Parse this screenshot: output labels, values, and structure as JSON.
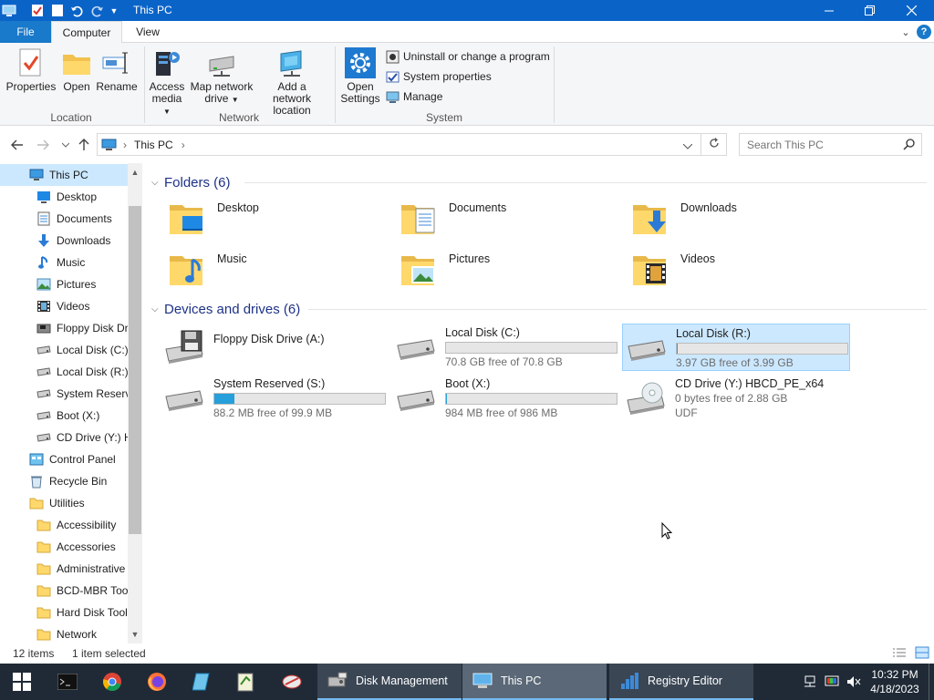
{
  "window": {
    "title": "This PC"
  },
  "ribbon": {
    "tabs": {
      "file": "File",
      "computer": "Computer",
      "view": "View"
    },
    "location": {
      "label": "Location",
      "properties": "Properties",
      "open": "Open",
      "rename": "Rename"
    },
    "network": {
      "label": "Network",
      "access_media_1": "Access",
      "access_media_2": "media",
      "map_drive_1": "Map network",
      "map_drive_2": "drive",
      "add_location_1": "Add a network",
      "add_location_2": "location"
    },
    "system": {
      "label": "System",
      "open_settings_1": "Open",
      "open_settings_2": "Settings",
      "uninstall": "Uninstall or change a program",
      "system_properties": "System properties",
      "manage": "Manage"
    }
  },
  "address": {
    "path": "This PC",
    "search_placeholder": "Search This PC"
  },
  "nav": {
    "items": [
      {
        "label": "This PC",
        "icon": "computer-icon",
        "level": 1,
        "selected": true
      },
      {
        "label": "Desktop",
        "icon": "desktop-icon",
        "level": 2
      },
      {
        "label": "Documents",
        "icon": "documents-icon",
        "level": 2
      },
      {
        "label": "Downloads",
        "icon": "downloads-icon",
        "level": 2
      },
      {
        "label": "Music",
        "icon": "music-icon",
        "level": 2
      },
      {
        "label": "Pictures",
        "icon": "pictures-icon",
        "level": 2
      },
      {
        "label": "Videos",
        "icon": "videos-icon",
        "level": 2
      },
      {
        "label": "Floppy Disk Dri",
        "icon": "floppy-icon",
        "level": 2
      },
      {
        "label": "Local Disk (C:)",
        "icon": "drive-icon",
        "level": 2
      },
      {
        "label": "Local Disk (R:)",
        "icon": "drive-icon",
        "level": 2
      },
      {
        "label": "System Reserve",
        "icon": "drive-icon",
        "level": 2
      },
      {
        "label": "Boot (X:)",
        "icon": "drive-icon",
        "level": 2
      },
      {
        "label": "CD Drive (Y:) H",
        "icon": "drive-icon",
        "level": 2
      },
      {
        "label": "Control Panel",
        "icon": "control-panel-icon",
        "level": 1
      },
      {
        "label": "Recycle Bin",
        "icon": "recycle-bin-icon",
        "level": 1
      },
      {
        "label": "Utilities",
        "icon": "folder-icon",
        "level": 1
      },
      {
        "label": "Accessibility",
        "icon": "folder-icon",
        "level": 2
      },
      {
        "label": "Accessories",
        "icon": "folder-icon",
        "level": 2
      },
      {
        "label": "Administrative",
        "icon": "folder-icon",
        "level": 2
      },
      {
        "label": "BCD-MBR Tool",
        "icon": "folder-icon",
        "level": 2
      },
      {
        "label": "Hard Disk Tool:",
        "icon": "folder-icon",
        "level": 2
      },
      {
        "label": "Network",
        "icon": "folder-icon",
        "level": 2
      }
    ]
  },
  "content": {
    "folders_header": "Folders (6)",
    "folders": [
      {
        "name": "Desktop",
        "icon": "desktop-folder-icon"
      },
      {
        "name": "Documents",
        "icon": "documents-folder-icon"
      },
      {
        "name": "Downloads",
        "icon": "downloads-folder-icon"
      },
      {
        "name": "Music",
        "icon": "music-folder-icon"
      },
      {
        "name": "Pictures",
        "icon": "pictures-folder-icon"
      },
      {
        "name": "Videos",
        "icon": "videos-folder-icon"
      }
    ],
    "drives_header": "Devices and drives (6)",
    "drives": [
      {
        "name": "Floppy Disk Drive (A:)",
        "icon": "floppy-drive-icon"
      },
      {
        "name": "Local Disk (C:)",
        "free": "70.8 GB free of 70.8 GB",
        "used_fraction": 0.0,
        "icon": "hard-drive-icon"
      },
      {
        "name": "Local Disk (R:)",
        "free": "3.97 GB free of 3.99 GB",
        "used_fraction": 0.005,
        "icon": "hard-drive-icon",
        "selected": true
      },
      {
        "name": "System Reserved (S:)",
        "free": "88.2 MB free of 99.9 MB",
        "used_fraction": 0.117,
        "icon": "hard-drive-icon"
      },
      {
        "name": "Boot (X:)",
        "free": "984 MB free of 986 MB",
        "used_fraction": 0.002,
        "icon": "hard-drive-icon"
      },
      {
        "name": "CD Drive (Y:) HBCD_PE_x64",
        "line2": "0 bytes free of 2.88 GB",
        "line3": "UDF",
        "icon": "cd-drive-icon"
      }
    ]
  },
  "status": {
    "items": "12 items",
    "selected": "1 item selected"
  },
  "taskbar": {
    "tasks": [
      {
        "label": "Disk Management",
        "icon": "disk-management-icon"
      },
      {
        "label": "This PC",
        "icon": "explorer-icon"
      },
      {
        "label": "Registry Editor",
        "icon": "registry-editor-icon"
      }
    ],
    "clock_time": "10:32 PM",
    "clock_date": "4/18/2023"
  },
  "colors": {
    "accent": "#0a64c8",
    "selection": "#cce8ff",
    "drive_bar": "#26a0da",
    "taskbar": "#1f2a36"
  }
}
